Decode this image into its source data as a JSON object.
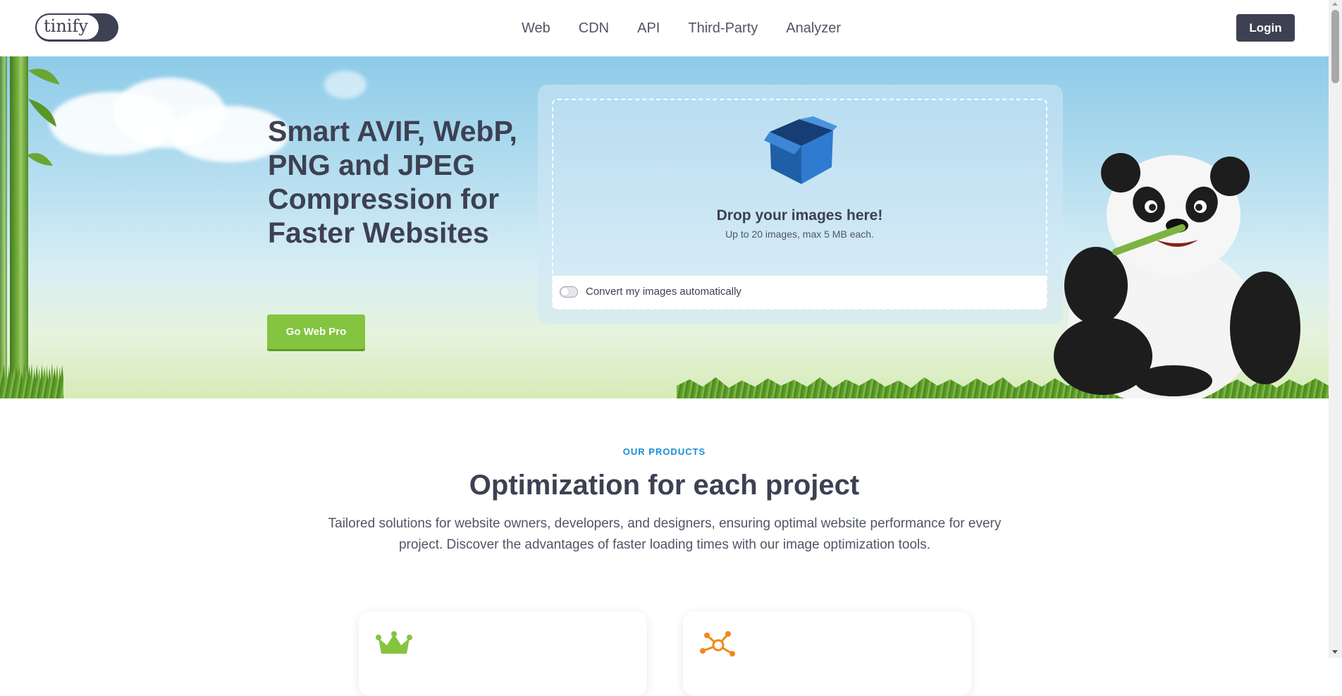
{
  "header": {
    "logo_text": "tinify",
    "nav": [
      "Web",
      "CDN",
      "API",
      "Third-Party",
      "Analyzer"
    ],
    "login_label": "Login"
  },
  "hero": {
    "title": "Smart AVIF, WebP, PNG and JPEG Compression for Faster Websites",
    "cta_label": "Go Web Pro",
    "dropzone": {
      "title": "Drop your images here!",
      "subtitle": "Up to 20 images, max 5 MB each.",
      "toggle_label": "Convert my images automatically",
      "toggle_on": false
    }
  },
  "products": {
    "eyebrow": "OUR PRODUCTS",
    "title": "Optimization for each project",
    "description": "Tailored solutions for website owners, developers, and designers, ensuring optimal website performance for every project. Discover the advantages of faster loading times with our image optimization tools.",
    "cards": [
      {
        "icon": "crown-icon",
        "color": "#84c43f"
      },
      {
        "icon": "network-icon",
        "color": "#f08a1c"
      }
    ]
  },
  "colors": {
    "accent_green": "#84c43f",
    "dark": "#3d4152",
    "link_blue": "#1b8ed4",
    "orange": "#f08a1c"
  }
}
